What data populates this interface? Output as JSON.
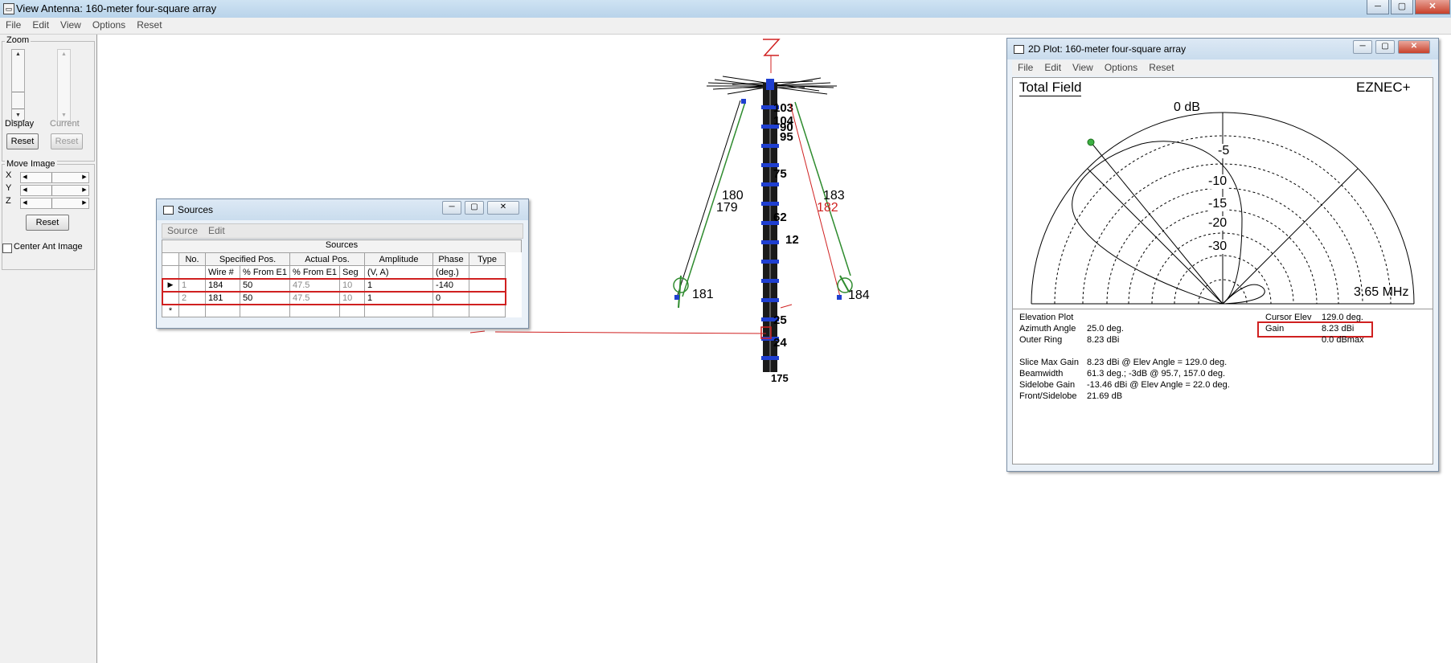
{
  "window": {
    "title": "View Antenna: 160-meter four-square array",
    "menu": [
      "File",
      "Edit",
      "View",
      "Options",
      "Reset"
    ]
  },
  "left_panel": {
    "zoom_label": "Zoom",
    "display_label": "Display",
    "current_label": "Current",
    "reset_label": "Reset",
    "reset_disabled_label": "Reset",
    "move_image_label": "Move Image",
    "axes": [
      "X",
      "Y",
      "Z"
    ],
    "move_reset_label": "Reset",
    "center_ant_label": "Center Ant Image",
    "center_ant_checked": false
  },
  "sources_window": {
    "title": "Sources",
    "menu": [
      "Source",
      "Edit"
    ],
    "table_title": "Sources",
    "group_headers": [
      "No.",
      "Specified Pos.",
      "Actual Pos.",
      "Amplitude",
      "Phase",
      "Type"
    ],
    "sub_headers": [
      "Wire #",
      "% From E1",
      "% From E1",
      "Seg",
      "(V, A)",
      "(deg.)"
    ],
    "rows": [
      {
        "no": "1",
        "wire": "184",
        "spec_pct": "50",
        "act_pct": "47.5",
        "seg": "10",
        "amplitude": "1",
        "phase": "-140",
        "type": ""
      },
      {
        "no": "2",
        "wire": "181",
        "spec_pct": "50",
        "act_pct": "47.5",
        "seg": "10",
        "amplitude": "1",
        "phase": "0",
        "type": ""
      }
    ],
    "new_row_marker": "*"
  },
  "antenna_view": {
    "wire_labels": [
      "180",
      "179",
      "183",
      "182",
      "181",
      "184"
    ],
    "tower_labels": [
      "103",
      "104",
      "90",
      "95",
      "75",
      "62",
      "12",
      "25",
      "24",
      "175"
    ],
    "colors": {
      "wire": "#2e8b2e",
      "segment": "#1f3fd0",
      "highlight": "#e03030",
      "source_line": "#d02020"
    }
  },
  "plot_window": {
    "title": "2D Plot: 160-meter four-square array",
    "menu": [
      "File",
      "Edit",
      "View",
      "Options",
      "Reset"
    ],
    "field_label": "Total Field",
    "brand": "EZNEC+",
    "ring_labels": [
      "0 dB",
      "-5",
      "-10",
      "-15",
      "-20",
      "-30"
    ],
    "frequency": "3.65 MHz",
    "info_left": [
      [
        "Elevation Plot",
        ""
      ],
      [
        "Azimuth Angle",
        "25.0 deg."
      ],
      [
        "Outer Ring",
        "8.23 dBi"
      ],
      [
        "",
        ""
      ],
      [
        "Slice Max Gain",
        "8.23 dBi @ Elev Angle = 129.0 deg."
      ],
      [
        "Beamwidth",
        "61.3 deg.; -3dB @ 95.7, 157.0 deg."
      ],
      [
        "Sidelobe Gain",
        "-13.46 dBi @ Elev Angle = 22.0 deg."
      ],
      [
        "Front/Sidelobe",
        "21.69 dB"
      ]
    ],
    "info_right": {
      "cursor_elev_label": "Cursor Elev",
      "cursor_elev_value": "129.0 deg.",
      "gain_label": "Gain",
      "gain_value": "8.23 dBi",
      "extra": "0.0 dBmax"
    }
  }
}
